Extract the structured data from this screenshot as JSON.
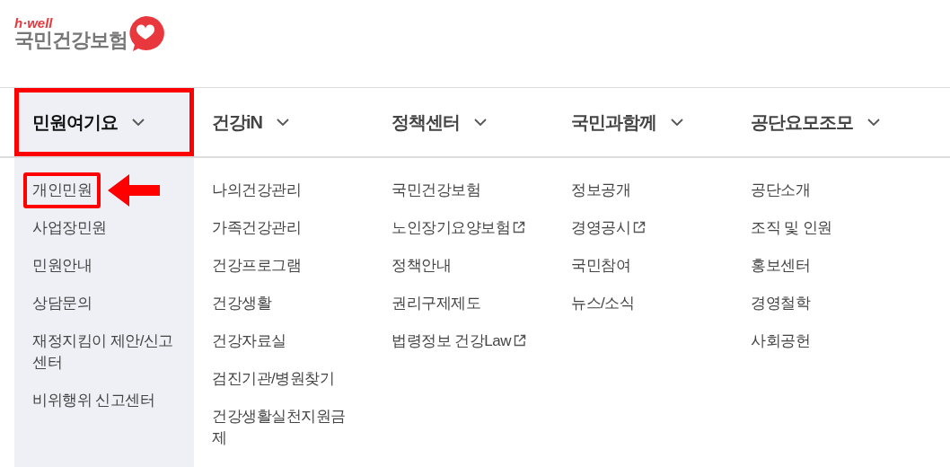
{
  "logo": {
    "tagline": "h·well",
    "name": "국민건강보험"
  },
  "menus": [
    {
      "label": "민원여기요",
      "selected": true,
      "highlighted": true,
      "items": [
        {
          "label": "개인민원",
          "highlighted": true
        },
        {
          "label": "사업장민원"
        },
        {
          "label": "민원안내"
        },
        {
          "label": "상담문의"
        },
        {
          "label": "재정지킴이 제안/신고센터"
        },
        {
          "label": "비위행위 신고센터"
        }
      ]
    },
    {
      "label": "건강iN",
      "selected": false,
      "items": [
        {
          "label": "나의건강관리"
        },
        {
          "label": "가족건강관리"
        },
        {
          "label": "건강프로그램"
        },
        {
          "label": "건강생활"
        },
        {
          "label": "건강자료실"
        },
        {
          "label": "검진기관/병원찾기"
        },
        {
          "label": "건강생활실천지원금제"
        }
      ]
    },
    {
      "label": "정책센터",
      "selected": false,
      "items": [
        {
          "label": "국민건강보험"
        },
        {
          "label": "노인장기요양보험",
          "external": true
        },
        {
          "label": "정책안내"
        },
        {
          "label": "권리구제제도"
        },
        {
          "label": "법령정보 건강Law",
          "external": true
        }
      ]
    },
    {
      "label": "국민과함께",
      "selected": false,
      "items": [
        {
          "label": "정보공개"
        },
        {
          "label": "경영공시",
          "external": true
        },
        {
          "label": "국민참여"
        },
        {
          "label": "뉴스/소식"
        }
      ]
    },
    {
      "label": "공단요모조모",
      "selected": false,
      "items": [
        {
          "label": "공단소개"
        },
        {
          "label": "조직 및 인원"
        },
        {
          "label": "홍보센터"
        },
        {
          "label": "경영철학"
        },
        {
          "label": "사회공헌"
        }
      ]
    }
  ]
}
